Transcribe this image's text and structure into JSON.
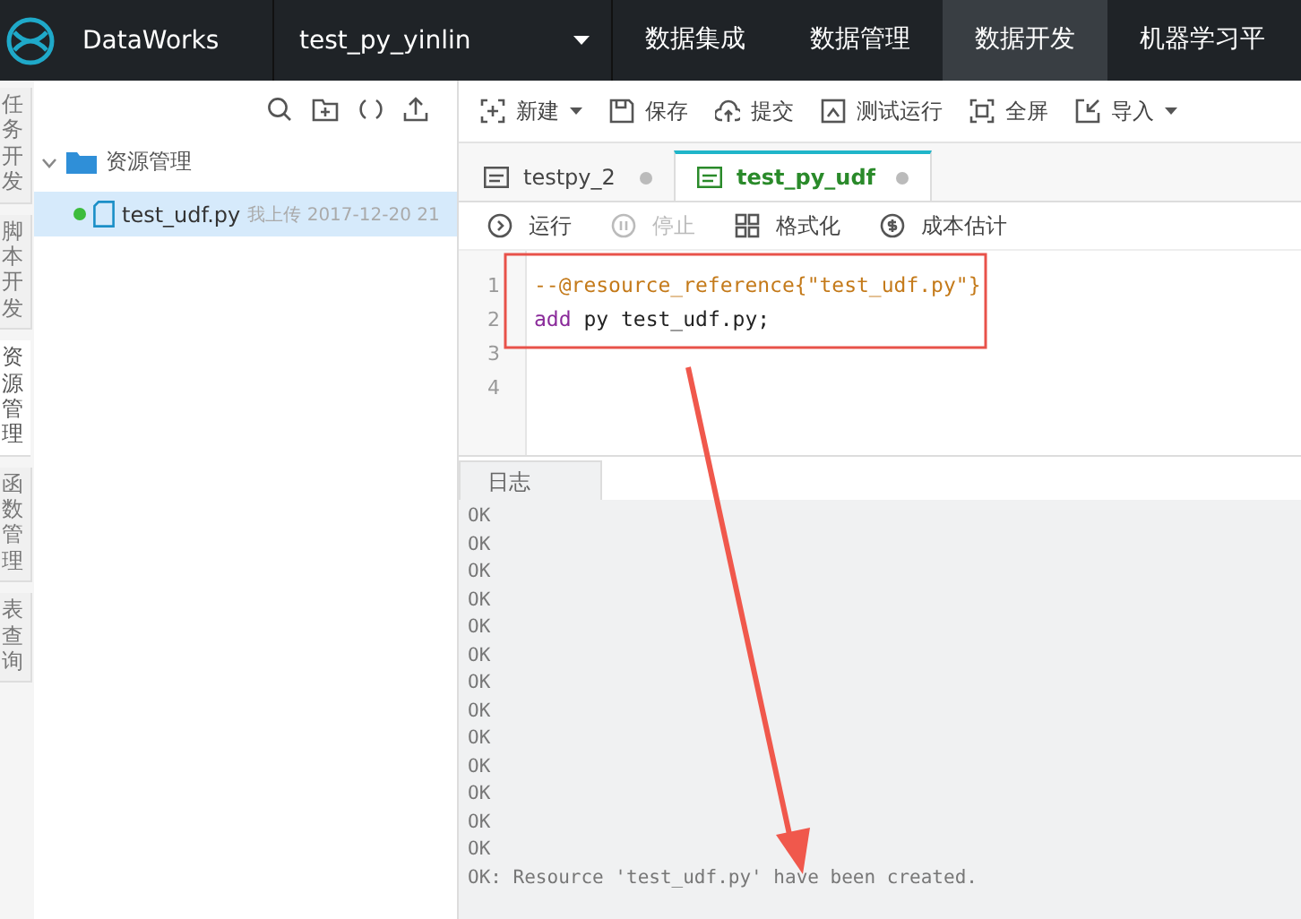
{
  "topbar": {
    "brand": "DataWorks",
    "project": "test_py_yinlin",
    "nav": [
      {
        "label": "数据集成",
        "selected": false
      },
      {
        "label": "数据管理",
        "selected": false
      },
      {
        "label": "数据开发",
        "selected": true
      },
      {
        "label": "机器学习平",
        "selected": false
      }
    ]
  },
  "side_tabs": [
    {
      "label": "任务开发",
      "selected": false
    },
    {
      "label": "脚本开发",
      "selected": false
    },
    {
      "label": "资源管理",
      "selected": true
    },
    {
      "label": "函数管理",
      "selected": false
    },
    {
      "label": "表查询",
      "selected": false
    }
  ],
  "tree": {
    "folder": {
      "label": "资源管理",
      "expanded": true
    },
    "items": [
      {
        "name": "test_udf.py",
        "meta": "我上传 2017-12-20 21",
        "selected": true
      }
    ]
  },
  "toolbar": [
    {
      "label": "新建",
      "dropdown": true
    },
    {
      "label": "保存",
      "dropdown": false
    },
    {
      "label": "提交",
      "dropdown": false
    },
    {
      "label": "测试运行",
      "dropdown": false
    },
    {
      "label": "全屏",
      "dropdown": false
    },
    {
      "label": "导入",
      "dropdown": true
    }
  ],
  "tabs": [
    {
      "label": "testpy_2",
      "selected": false
    },
    {
      "label": "test_py_udf",
      "selected": true
    }
  ],
  "actions": [
    {
      "label": "运行",
      "disabled": false
    },
    {
      "label": "停止",
      "disabled": true
    },
    {
      "label": "格式化",
      "disabled": false
    },
    {
      "label": "成本估计",
      "disabled": false
    }
  ],
  "code": [
    {
      "number": "1",
      "tokens": [
        {
          "kind": "comment",
          "text": "--@resource_reference{\"test_udf.py\"}"
        }
      ]
    },
    {
      "number": "2",
      "tokens": [
        {
          "kind": "keyword",
          "text": "add"
        },
        {
          "kind": "plain",
          "text": " py test_udf.py;"
        }
      ]
    },
    {
      "number": "3"
    },
    {
      "number": "4"
    }
  ],
  "log": {
    "tab": "日志",
    "lines": [
      "OK",
      "OK",
      "OK",
      "OK",
      "OK",
      "OK",
      "OK",
      "OK",
      "OK",
      "OK",
      "OK",
      "OK",
      "OK",
      "OK: Resource 'test_udf.py' have been created."
    ]
  }
}
